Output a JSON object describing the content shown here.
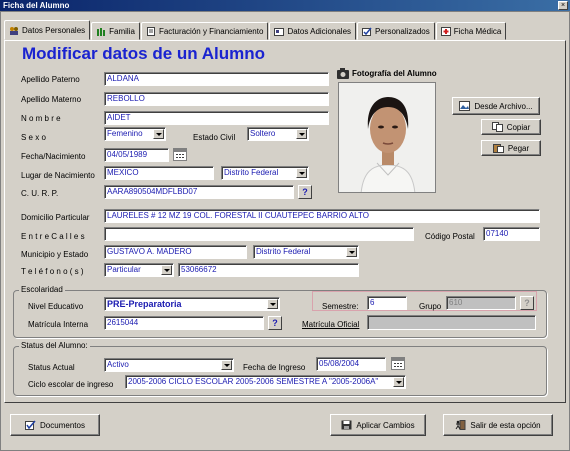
{
  "window": {
    "title": "Ficha del Alumno"
  },
  "tabs": [
    {
      "label": "Datos Personales"
    },
    {
      "label": "Familia"
    },
    {
      "label": "Facturación y Financiamiento"
    },
    {
      "label": "Datos Adicionales"
    },
    {
      "label": "Personalizados"
    },
    {
      "label": "Ficha Médica"
    }
  ],
  "heading": "Modificar datos de un Alumno",
  "photo": {
    "label": "Fotografía del Alumno",
    "from_file": "Desde Archivo...",
    "copy": "Copiar",
    "paste": "Pegar"
  },
  "fields": {
    "apellido_paterno": {
      "label": "Apellido Paterno",
      "value": "ALDANA"
    },
    "apellido_materno": {
      "label": "Apellido Materno",
      "value": "REBOLLO"
    },
    "nombre": {
      "label": "N o m b r e",
      "value": "AIDET"
    },
    "sexo": {
      "label": "S e x o",
      "value": "Femenino"
    },
    "estado_civil": {
      "label": "Estado Civil",
      "value": "Soltero"
    },
    "fecha_nacimiento": {
      "label": "Fecha/Nacimiento",
      "value": "04/05/1989"
    },
    "lugar_nacimiento": {
      "label": "Lugar de Nacimiento",
      "value": "MEXICO",
      "state": "Distrito Federal"
    },
    "curp": {
      "label": "C. U. R. P.",
      "value": "AARA890504MDFLBD07"
    },
    "domicilio": {
      "label": "Domicilio Particular",
      "value": "LAURELES # 12 MZ 19 COL. FORESTAL II CUAUTEPEC BARRIO ALTO"
    },
    "entre_calles": {
      "label": "E n t r e   C a l l e s",
      "value": ""
    },
    "codigo_postal": {
      "label": "Código Postal",
      "value": "07140"
    },
    "municipio": {
      "label": "Municipio y Estado",
      "value": "GUSTAVO A. MADERO",
      "state": "Distrito Federal"
    },
    "telefono": {
      "label": "T e l é f o n o  ( s )",
      "type": "Particular",
      "value": "53066672"
    }
  },
  "escolaridad": {
    "legend": "Escolaridad",
    "nivel_label": "Nivel Educativo",
    "nivel_value": "PRE-Preparatoria",
    "semestre_label": "Semestre:",
    "semestre_value": "6",
    "grupo_label": "Grupo",
    "grupo_value": "610",
    "matricula_label": "Matrícula Interna",
    "matricula_value": "2615044",
    "matricula_oficial_label": "Matrícula Oficial",
    "matricula_oficial_value": ""
  },
  "status": {
    "legend": "Status del Alumno:",
    "actual_label": "Status Actual",
    "actual_value": "Activo",
    "ingreso_label": "Fecha de Ingreso",
    "ingreso_value": "05/08/2004",
    "ciclo_label": "Ciclo escolar de ingreso",
    "ciclo_value": "2005-2006 CICLO ESCOLAR 2005-2006 SEMESTRE A \"2005-2006A\""
  },
  "footer": {
    "documentos": "Documentos",
    "aplicar": "Aplicar Cambios",
    "salir": "Salir de esta opción"
  },
  "help_glyph": "?",
  "colors": {
    "heading": "#1a23d0",
    "value_text": "#1a1ab0",
    "titlebar": "#0a246a"
  }
}
